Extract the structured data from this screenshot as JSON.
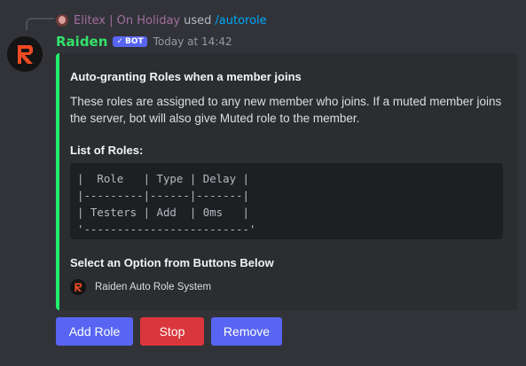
{
  "reply": {
    "username": "Elitex | On Holiday",
    "used_text": "used",
    "command": "/autorole"
  },
  "message": {
    "username": "Raiden",
    "bot_tag": "BOT",
    "timestamp": "Today at 14:42"
  },
  "embed": {
    "accent_color": "#22ee6c",
    "title": "Auto-granting Roles when a member joins",
    "description": "These roles are assigned to any new member who joins. If a muted member joins the server, bot will also give Muted role to the member.",
    "field_name": "List of Roles:",
    "code": "|  Role   | Type | Delay |\n|---------|------|-------|\n| Testers | Add  | 0ms   |\n'-------------------------'",
    "subheading": "Select an Option from Buttons Below",
    "footer_text": "Raiden Auto Role System"
  },
  "buttons": {
    "add_role": "Add Role",
    "stop": "Stop",
    "remove": "Remove"
  },
  "colors": {
    "primary_button": "#5865f2",
    "danger_button": "#da373c",
    "bot_name": "#33e26a"
  },
  "icons": {
    "bot_avatar": "raiden-logo-icon",
    "bot_tag_check": "check-icon",
    "footer": "raiden-logo-icon"
  }
}
